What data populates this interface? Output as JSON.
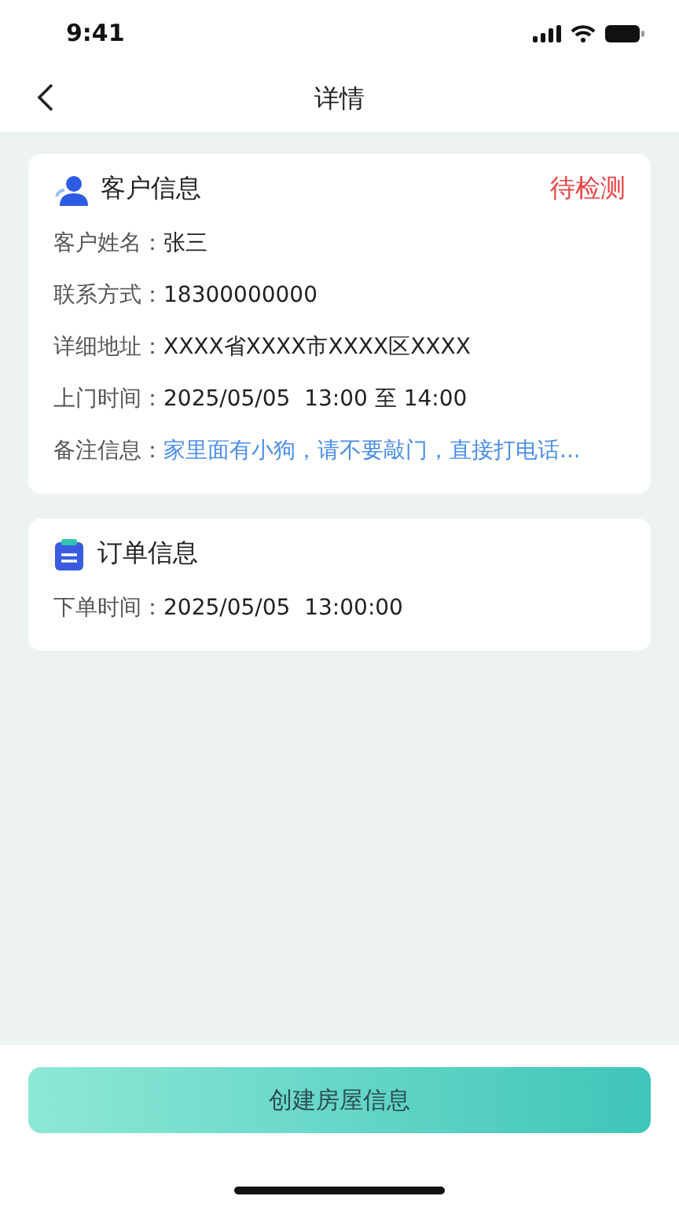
{
  "status_bar": {
    "time": "9:41"
  },
  "nav": {
    "title": "详情"
  },
  "customer_card": {
    "title": "客户信息",
    "status": "待检测",
    "fields": [
      {
        "label": "客户姓名：",
        "value": "张三",
        "kind": "plain"
      },
      {
        "label": "联系方式：",
        "value": "18300000000",
        "kind": "plain"
      },
      {
        "label": "详细地址：",
        "value": "XXXX省XXXX市XXXX区XXXX",
        "kind": "plain"
      },
      {
        "label": "上门时间：",
        "value": "2025/05/05  13:00 至 14:00",
        "kind": "plain"
      },
      {
        "label": "备注信息：",
        "value": "家里面有小狗，请不要敲门，直接打电话...",
        "kind": "note"
      }
    ]
  },
  "order_card": {
    "title": "订单信息",
    "fields": [
      {
        "label": "下单时间：",
        "value": "2025/05/05  13:00:00"
      }
    ]
  },
  "action_button": {
    "label": "创建房屋信息"
  }
}
